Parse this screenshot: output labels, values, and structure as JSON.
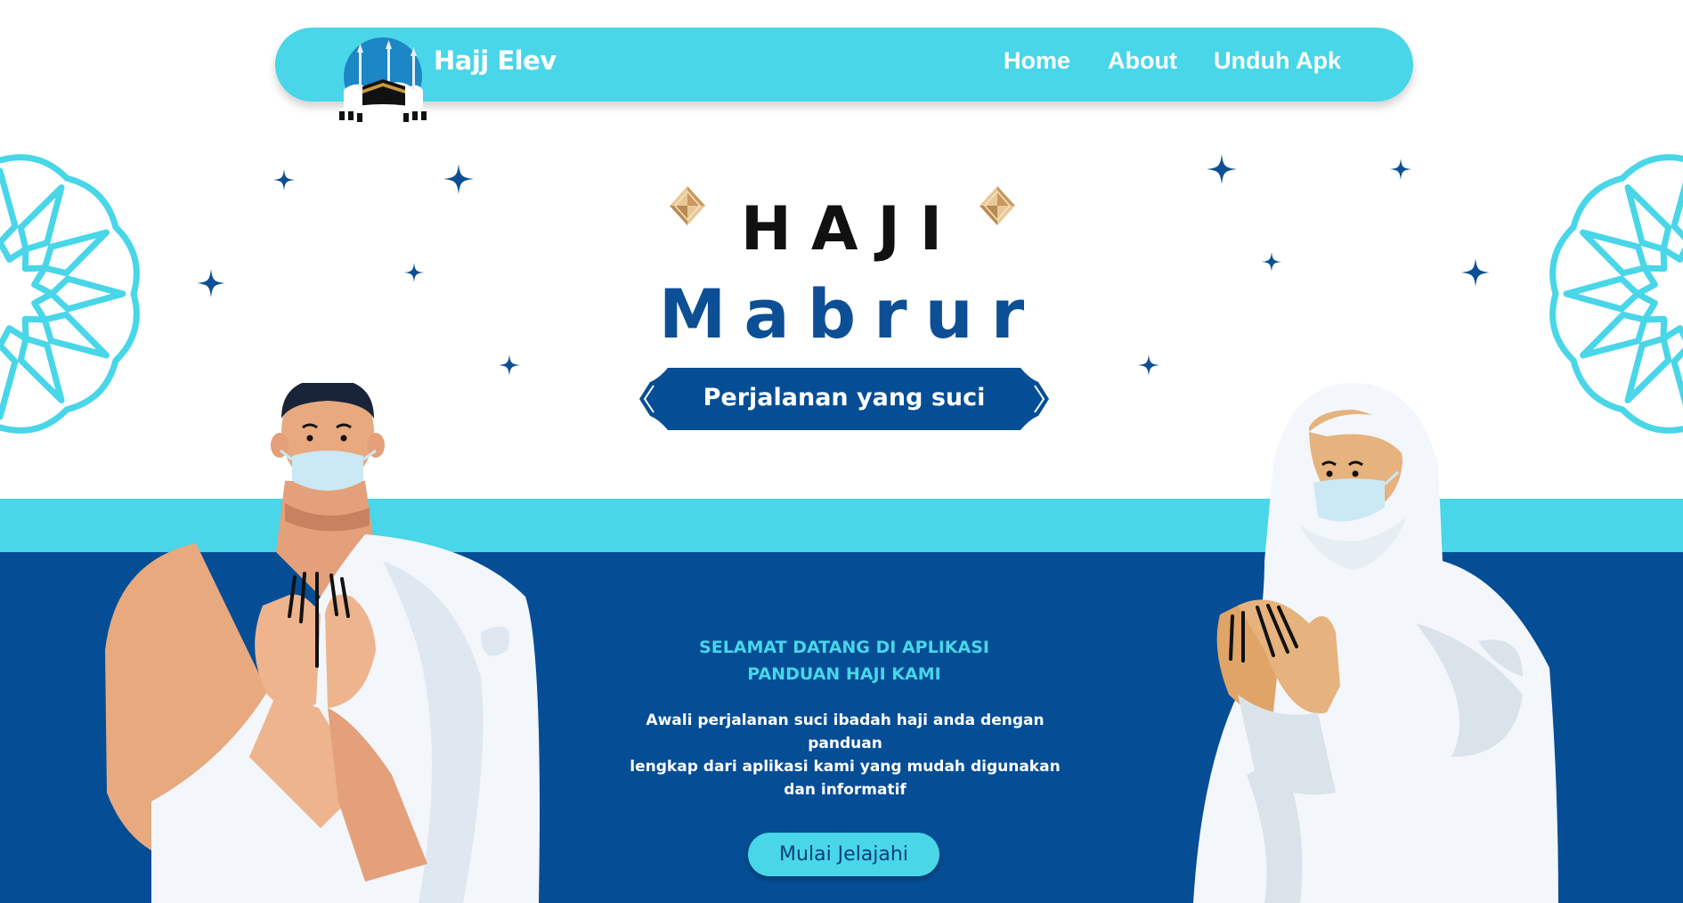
{
  "brand": {
    "name": "Hajj Elev",
    "logo_icon": "kaaba-icon"
  },
  "nav": {
    "items": [
      {
        "label": "Home"
      },
      {
        "label": "About"
      },
      {
        "label": "Unduh Apk"
      }
    ]
  },
  "hero": {
    "title_line1": "HAJI",
    "title_line2": "Mabrur",
    "tagline": "Perjalanan yang suci"
  },
  "welcome": {
    "heading_line1": "SELAMAT DATANG DI APLIKASI",
    "heading_line2": "PANDUAN HAJI KAMI",
    "description_line1": "Awali perjalanan suci ibadah haji anda dengan panduan",
    "description_line2": "lengkap dari aplikasi kami yang mudah digunakan dan informatif",
    "cta_label": "Mulai Jelajahi"
  },
  "colors": {
    "accent_cyan": "#48d6e8",
    "navy": "#054e96",
    "title_blue": "#0d4f94",
    "gold": "#d9b47a"
  },
  "icons": {
    "ornament": "geometric-rosette-icon",
    "star": "sparkle-star-icon",
    "diamond": "diamond-ornament-icon"
  }
}
